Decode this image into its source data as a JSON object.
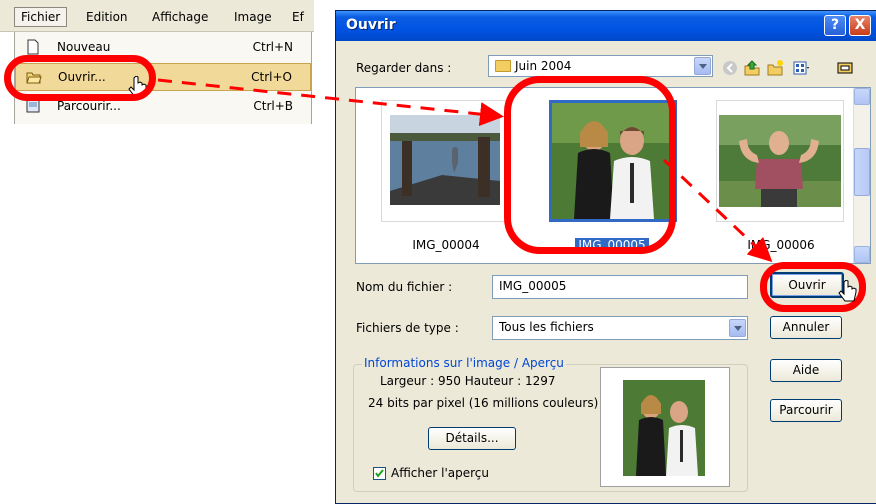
{
  "menu": {
    "menubar": [
      "Fichier",
      "Edition",
      "Affichage",
      "Image",
      "Ef"
    ],
    "items": [
      {
        "label": "Nouveau",
        "shortcut": "Ctrl+N"
      },
      {
        "label": "Ouvrir...",
        "shortcut": "Ctrl+O"
      },
      {
        "label": "Parcourir...",
        "shortcut": "Ctrl+B"
      }
    ]
  },
  "dialog": {
    "title": "Ouvrir",
    "help_button": "?",
    "close_button": "X",
    "look_in_label": "Regarder dans :",
    "look_in_value": "Juin 2004",
    "files": [
      {
        "name": "IMG_00004",
        "selected": false
      },
      {
        "name": "IMG_00005",
        "selected": true
      },
      {
        "name": "IMG_00006",
        "selected": false
      }
    ],
    "filename_label": "Nom du fichier :",
    "filename_value": "IMG_00005",
    "filetype_label": "Fichiers de type :",
    "filetype_value": "Tous les fichiers",
    "buttons": {
      "open": "Ouvrir",
      "cancel": "Annuler",
      "help": "Aide",
      "browse": "Parcourir"
    },
    "info": {
      "group_title": "Informations sur l'image / Aperçu",
      "dimensions": "Largeur : 950  Hauteur : 1297",
      "bits": "24 bits par pixel (16 millions couleurs)",
      "details_button": "Détails...",
      "preview_checkbox": "Afficher l'aperçu",
      "preview_checked": true
    }
  },
  "colors": {
    "annotation_red": "#ff0000",
    "title_bar_blue": "#0054e3",
    "selection_blue": "#316ac5",
    "menu_highlight": "#f1d99a",
    "dialog_face": "#ece9d8"
  }
}
